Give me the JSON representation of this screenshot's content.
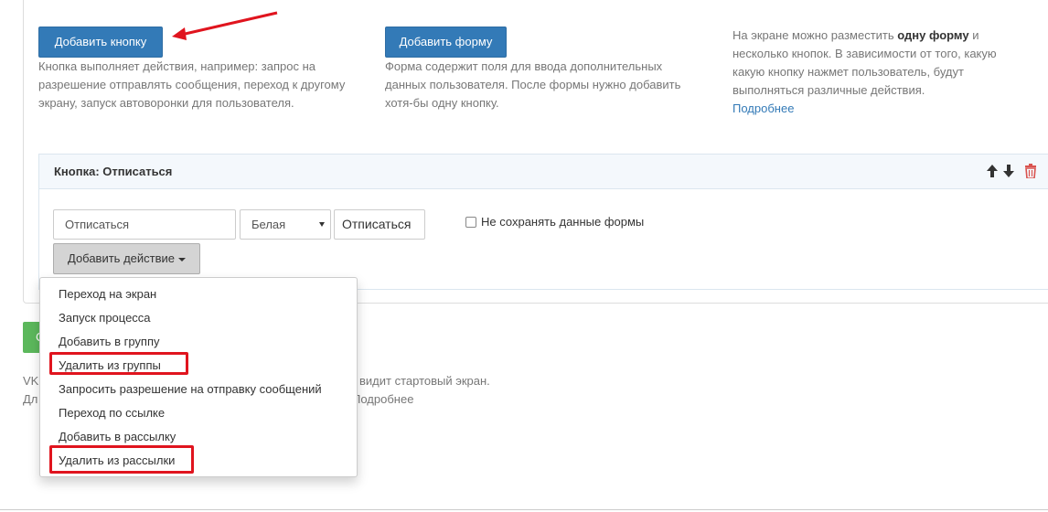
{
  "top": {
    "add_button": {
      "label": "Добавить кнопку",
      "desc": "Кнопка выполняет действия, например: запрос на разрешение отправлять сообщения, переход к другому экрану, запуск автоворонки для пользователя."
    },
    "add_form": {
      "label": "Добавить форму",
      "desc": "Форма содержит поля для ввода дополнительных данных пользователя. После формы нужно добавить хотя-бы одну кнопку."
    },
    "info": {
      "before": "На экране можно разместить ",
      "bold": "одну форму",
      "after": " и несколько кнопок. В зависимости от того, какую какую кнопку нажмет пользователь, будут выполняться различные действия.",
      "link": "Подробнее"
    }
  },
  "panel": {
    "title": "Кнопка: Отписаться",
    "name_value": "Отписаться",
    "color_value": "Белая",
    "preview_label": "Отписаться",
    "checkbox_label": "Не сохранять данные формы",
    "add_action_label": "Добавить действие"
  },
  "bottom": {
    "green_btn_char": "С",
    "line1_left": "VK",
    "line1_right": "видит стартовый экран.",
    "line2_left": "Дл",
    "line2_link": "Подробнее"
  },
  "dropdown": {
    "items": [
      "Переход на экран",
      "Запуск процесса",
      "Добавить в группу",
      "Удалить из группы",
      "Запросить разрешение на отправку сообщений",
      "Переход по ссылке",
      "Добавить в рассылку",
      "Удалить из рассылки"
    ]
  },
  "colors": {
    "primary": "#337ab7",
    "highlight": "#e0141e",
    "success": "#5cb85c",
    "danger": "#d9534f"
  },
  "icons": {
    "annotation_arrow": "arrow-left-annotation",
    "move_up": "arrow-up-icon",
    "move_down": "arrow-down-icon",
    "delete": "trash-icon",
    "select_caret": "caret-down-icon"
  }
}
